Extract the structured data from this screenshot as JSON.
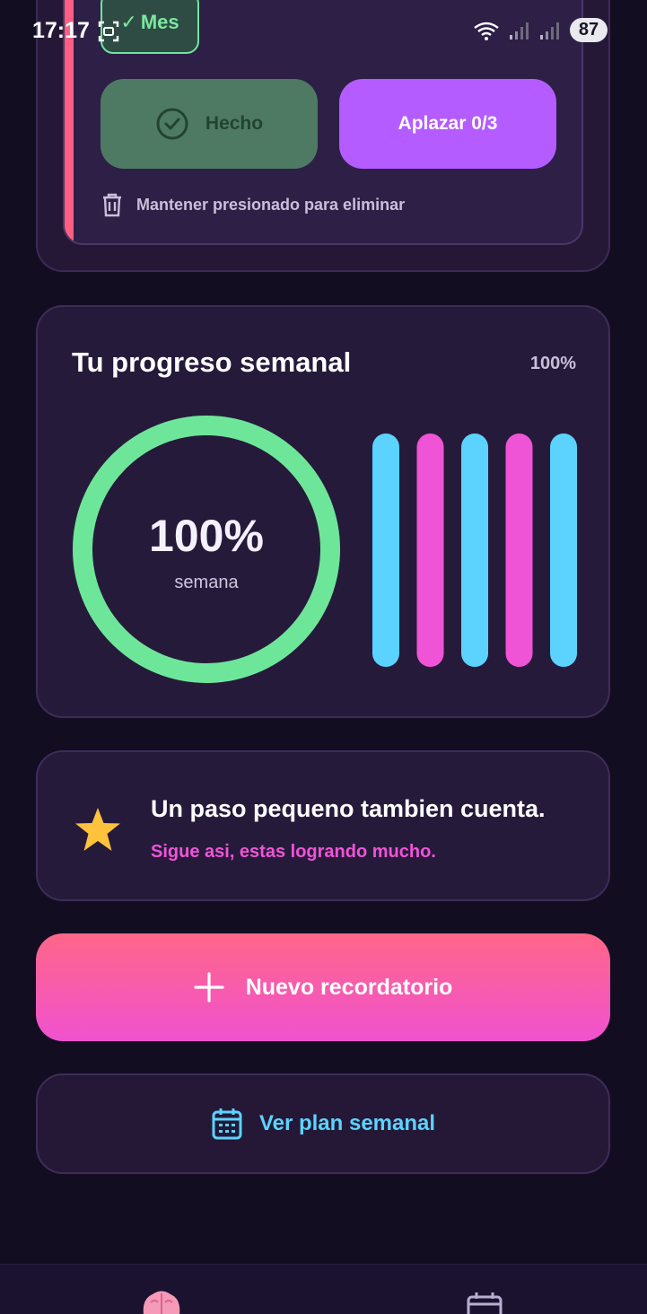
{
  "status_bar": {
    "time": "17:17",
    "battery": "87",
    "icons": [
      "screen-record-icon",
      "wifi-icon",
      "signal-icon",
      "signal-icon"
    ]
  },
  "reminder_card": {
    "chip_label": "Mes",
    "chip_icon": "check-icon",
    "done_label": "Hecho",
    "postpone_label": "Aplazar 0/3",
    "delete_hint": "Mantener presionado para eliminar",
    "accent_color": "#ff5d82"
  },
  "weekly_progress": {
    "title": "Tu progreso semanal",
    "percent_label": "100%",
    "ring_value": "100%",
    "ring_caption": "semana",
    "ring_fraction": 1.0,
    "ring_color": "#6ee69a",
    "bars": [
      {
        "fraction": 1.0,
        "color": "#5cd3ff"
      },
      {
        "fraction": 1.0,
        "color": "#f054d6"
      },
      {
        "fraction": 1.0,
        "color": "#5cd3ff"
      },
      {
        "fraction": 1.0,
        "color": "#f054d6"
      },
      {
        "fraction": 1.0,
        "color": "#5cd3ff"
      }
    ]
  },
  "motivation": {
    "icon": "star-icon",
    "title": "Un paso pequeno tambien cuenta.",
    "subtitle": "Sigue asi, estas logrando mucho."
  },
  "actions": {
    "new_reminder_label": "Nuevo recordatorio",
    "weekly_plan_label": "Ver plan semanal"
  },
  "bottom_nav": {
    "items": [
      "brain-icon",
      "calendar-icon"
    ]
  }
}
